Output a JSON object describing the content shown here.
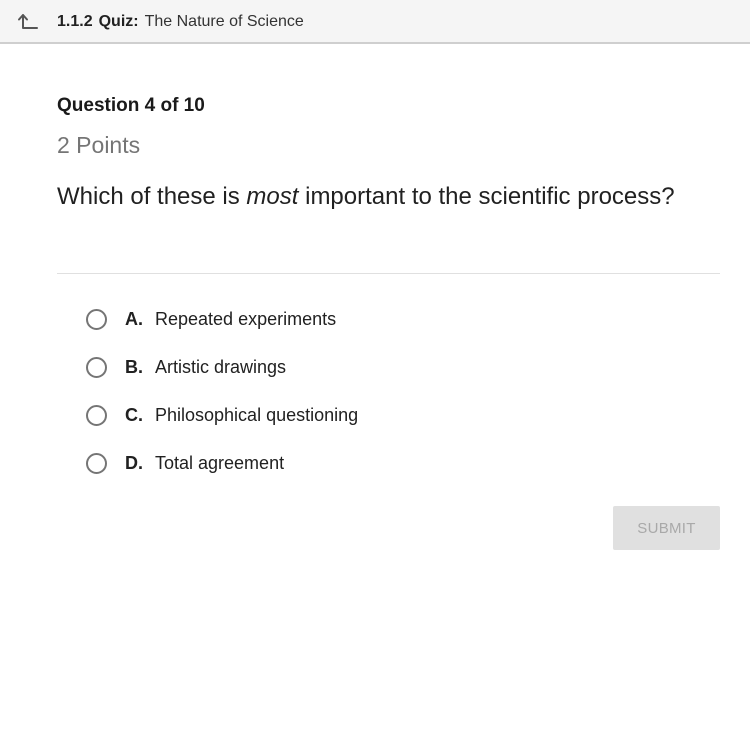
{
  "header": {
    "back_icon": "back-arrow-icon",
    "lesson_number": "1.1.2",
    "activity_type": "Quiz:",
    "activity_title": "The Nature of Science"
  },
  "question": {
    "counter": "Question 4 of 10",
    "points": "2 Points",
    "text_before": "Which of these is ",
    "text_emphasis": "most",
    "text_after": " important to the scientific process?"
  },
  "options": [
    {
      "letter": "A.",
      "text": "Repeated experiments",
      "selected": false
    },
    {
      "letter": "B.",
      "text": "Artistic drawings",
      "selected": false
    },
    {
      "letter": "C.",
      "text": "Philosophical questioning",
      "selected": false
    },
    {
      "letter": "D.",
      "text": "Total agreement",
      "selected": false
    }
  ],
  "submit": {
    "label": "SUBMIT",
    "enabled": false
  },
  "colors": {
    "header_bg": "#f5f5f5",
    "text_primary": "#212121",
    "text_secondary": "#757575",
    "button_disabled_bg": "#e0e0e0",
    "button_disabled_text": "#a9a9a9"
  }
}
